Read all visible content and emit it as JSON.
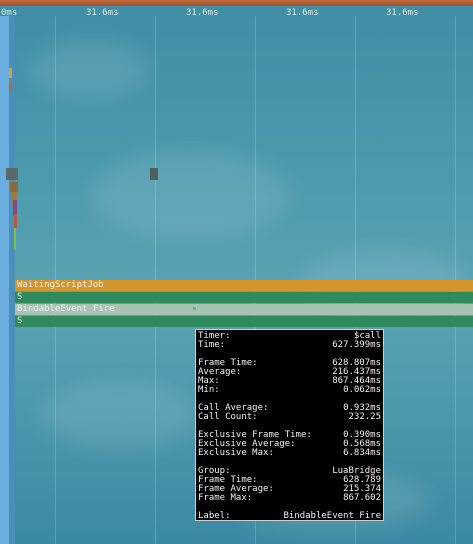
{
  "ruler": {
    "start_label": "0ms",
    "tick_labels": [
      "31.6ms",
      "31.6ms",
      "31.6ms",
      "31.6ms"
    ]
  },
  "rows": {
    "waiting": "WaitingScriptJob",
    "s1": "S",
    "bindable": "BindableEvent Fire",
    "s2": "S"
  },
  "tooltip": {
    "timer_label": "Timer:",
    "timer_value": "$call",
    "time_label": "Time:",
    "time_value": "627.399ms",
    "frame_time_label": "Frame Time:",
    "frame_time_value": "628.807ms",
    "average_label": "Average:",
    "average_value": "216.437ms",
    "max_label": "Max:",
    "max_value": "867.464ms",
    "min_label": "Min:",
    "min_value": "0.062ms",
    "call_average_label": "Call Average:",
    "call_average_value": "0.932ms",
    "call_count_label": "Call Count:",
    "call_count_value": "232.25",
    "excl_frame_time_label": "Exclusive Frame Time:",
    "excl_frame_time_value": "0.390ms",
    "excl_average_label": "Exclusive Average:",
    "excl_average_value": "0.568ms",
    "excl_max_label": "Exclusive Max:",
    "excl_max_value": "6.834ms",
    "group_label": "Group:",
    "group_value": "LuaBridge",
    "g_frame_time_label": "Frame Time:",
    "g_frame_time_value": "628.789",
    "g_frame_average_label": "Frame Average:",
    "g_frame_average_value": "215.374",
    "g_frame_max_label": "Frame Max:",
    "g_frame_max_value": "867.602",
    "label_label": "Label:",
    "label_value": "BindableEvent Fire"
  },
  "colors": {
    "waiting_bar": "#d4952d",
    "green_bar": "#2f8a5e",
    "bindable_bar": "#a7c4b3"
  }
}
